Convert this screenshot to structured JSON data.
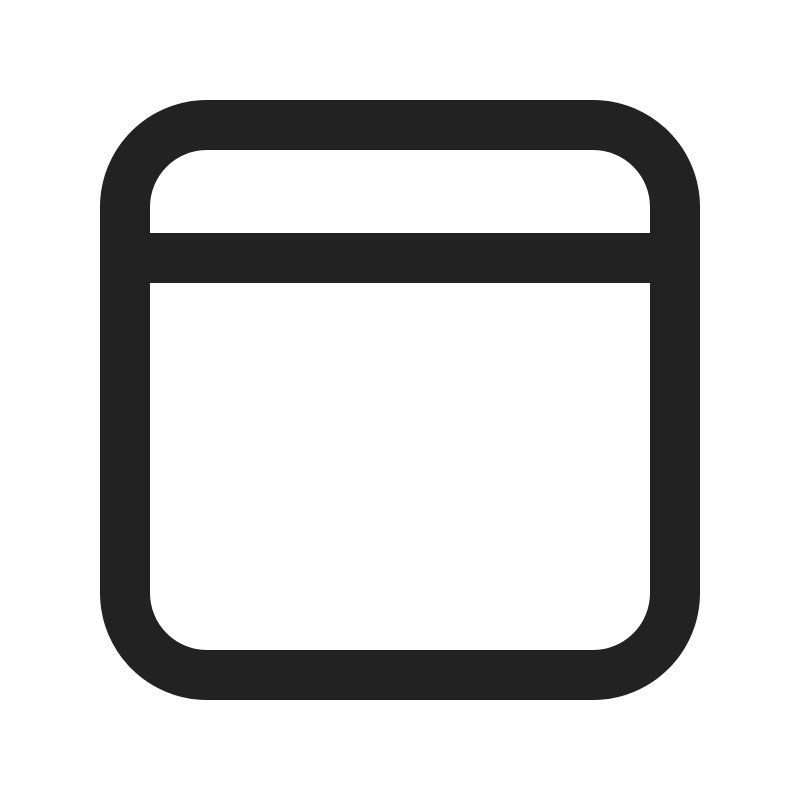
{
  "icon": {
    "name": "app-window-icon",
    "stroke_color": "#222222",
    "background_color": "#ffffff"
  }
}
